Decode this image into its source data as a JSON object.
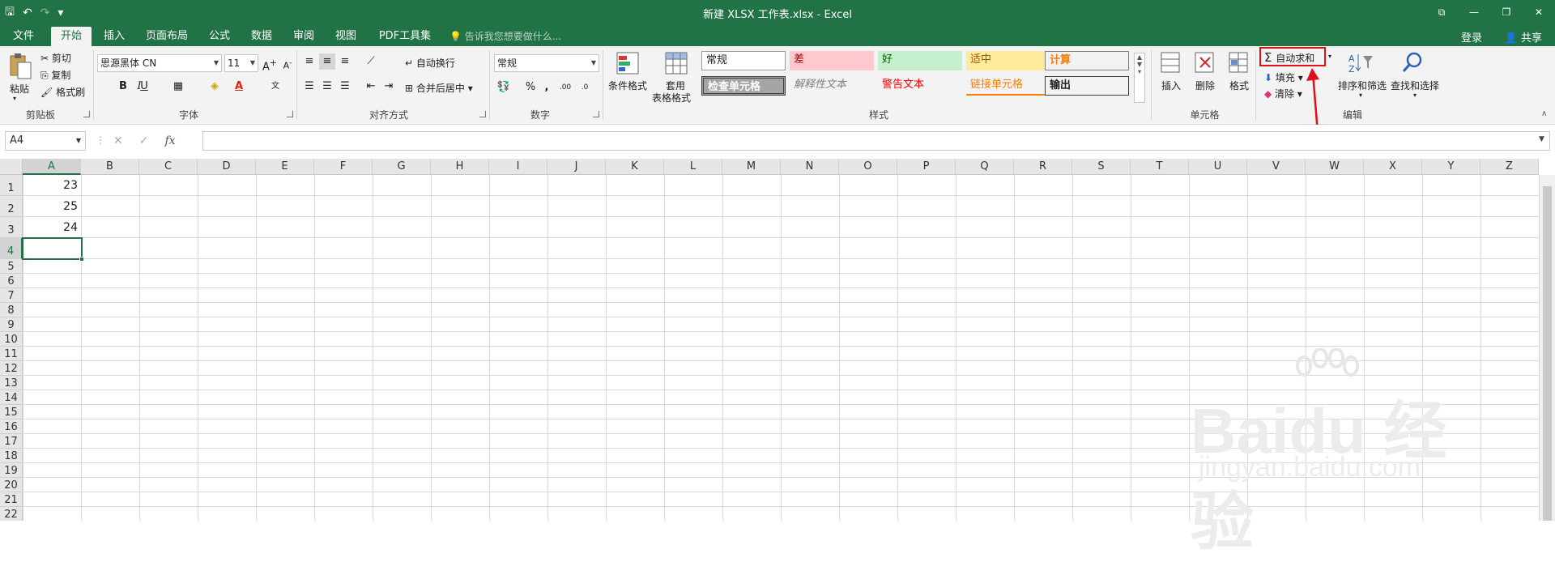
{
  "window": {
    "title": "新建 XLSX 工作表.xlsx - Excel",
    "qat": {
      "save": "🖫",
      "undo": "↶",
      "redo": "↷",
      "customize": "▾"
    },
    "controls": {
      "restore": "⧉",
      "minimize": "—",
      "maximize": "❐",
      "close": "✕"
    }
  },
  "tabs": [
    {
      "label": "文件"
    },
    {
      "label": "开始"
    },
    {
      "label": "插入"
    },
    {
      "label": "页面布局"
    },
    {
      "label": "公式"
    },
    {
      "label": "数据"
    },
    {
      "label": "审阅"
    },
    {
      "label": "视图"
    },
    {
      "label": "PDF工具集"
    }
  ],
  "tell_me": "告诉我您想要做什么...",
  "account": {
    "login": "登录",
    "share": "共享"
  },
  "ribbon": {
    "clipboard": {
      "label": "剪贴板",
      "paste": "粘贴",
      "cut": "剪切",
      "copy": "复制",
      "format_painter": "格式刷"
    },
    "font": {
      "label": "字体",
      "font_name": "思源黑体 CN",
      "font_size": "11",
      "bold": "B",
      "italic": "I",
      "underline": "U"
    },
    "alignment": {
      "label": "对齐方式",
      "wrap": "自动换行",
      "merge": "合并后居中"
    },
    "number": {
      "label": "数字",
      "format": "常规",
      "percent": "%"
    },
    "styles": {
      "label": "样式",
      "conditional": "条件格式",
      "table_format_1": "套用",
      "table_format_2": "表格格式",
      "cells": [
        {
          "text": "常规"
        },
        {
          "text": "差"
        },
        {
          "text": "好"
        },
        {
          "text": "适中"
        },
        {
          "text": "计算"
        },
        {
          "text": "检查单元格"
        },
        {
          "text": "解释性文本"
        },
        {
          "text": "警告文本"
        },
        {
          "text": "链接单元格"
        },
        {
          "text": "输出"
        }
      ]
    },
    "cells_group": {
      "label": "单元格",
      "insert": "插入",
      "delete": "删除",
      "format": "格式"
    },
    "editing": {
      "label": "编辑",
      "autosum": "自动求和",
      "fill": "填充",
      "clear": "清除",
      "sort": "排序和筛选",
      "find": "查找和选择"
    }
  },
  "formula_bar": {
    "name_box": "A4",
    "cancel": "✕",
    "enter": "✓",
    "fx": "fx",
    "value": ""
  },
  "sheet": {
    "columns": [
      "A",
      "B",
      "C",
      "D",
      "E",
      "F",
      "G",
      "H",
      "I",
      "J",
      "K",
      "L",
      "M",
      "N",
      "O",
      "P",
      "Q",
      "R",
      "S",
      "T",
      "U",
      "V",
      "W",
      "X",
      "Y",
      "Z"
    ],
    "rows": [
      "1",
      "2",
      "3",
      "4",
      "5",
      "6",
      "7",
      "8",
      "9",
      "10",
      "11",
      "12",
      "13",
      "14",
      "15",
      "16",
      "17",
      "18",
      "19",
      "20",
      "21",
      "22"
    ],
    "values": {
      "A1": "23",
      "A2": "25",
      "A3": "24"
    },
    "selected": "A4"
  },
  "watermark": {
    "brand": "Bai",
    "brand2": "du 经验",
    "url": "jingyan.baidu.com"
  },
  "colors": {
    "accent": "#217346",
    "annotation": "#e0101a"
  }
}
